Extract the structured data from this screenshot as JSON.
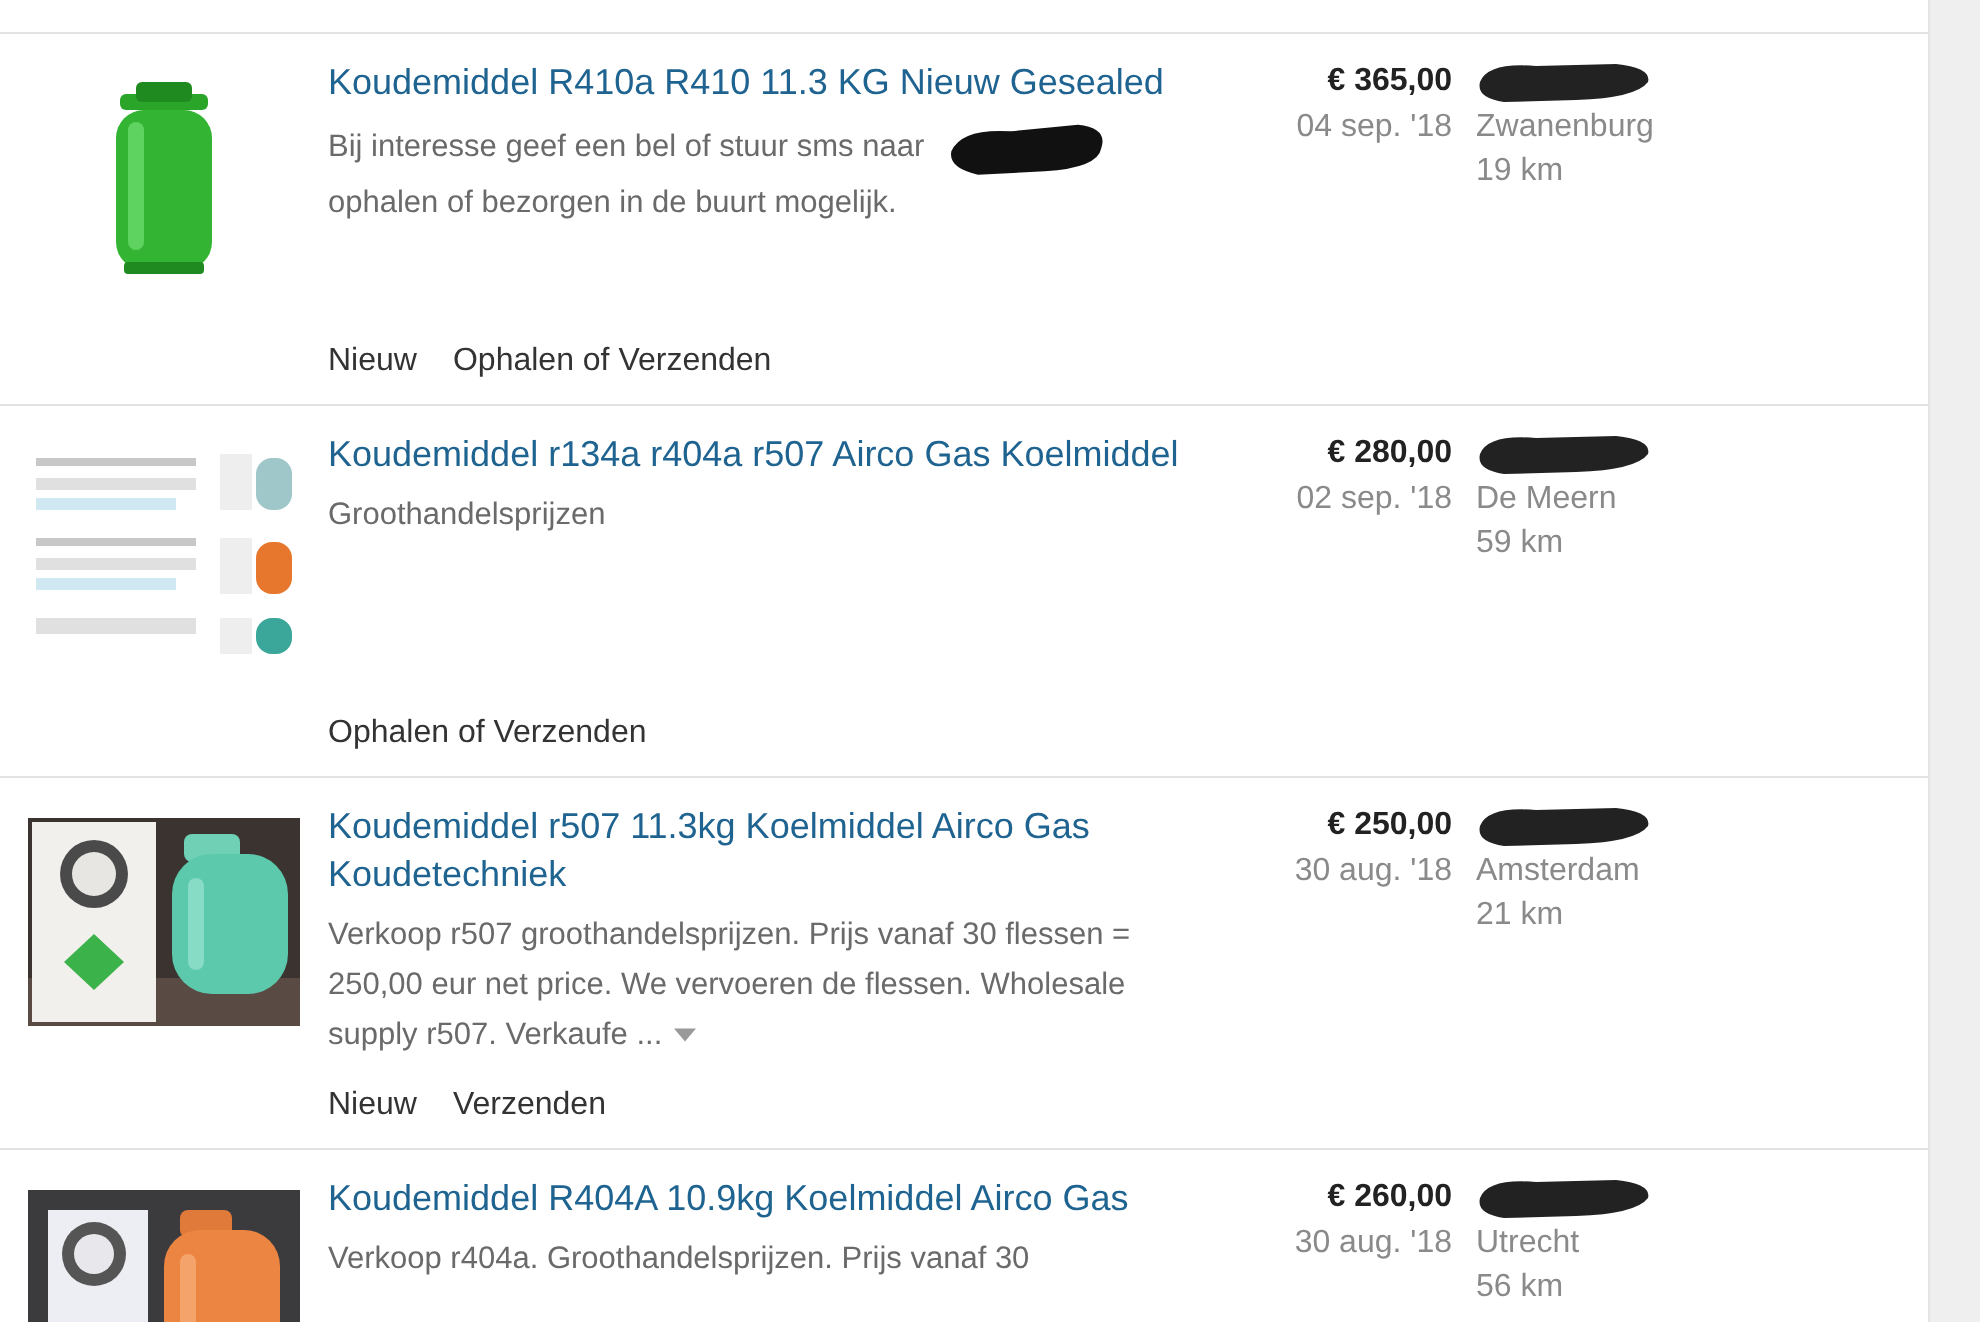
{
  "listings": [
    {
      "title": "Koudemiddel R410a R410 11.3 KG Nieuw Gesealed",
      "image": {
        "kind": "picture"
      },
      "description": [
        "Bij interesse geef een bel of stuur sms naar",
        "ophalen of bezorgen in de buurt mogelijk."
      ],
      "redacted_phone": true,
      "attributes": [
        "Nieuw",
        "Ophalen of Verzenden"
      ],
      "price": "€ 365,00",
      "date": "04 sep. '18",
      "seller_redacted": true,
      "location": "Zwanenburg",
      "distance": "19 km"
    },
    {
      "title": "Koudemiddel r134a r404a r507 Airco Gas Koelmiddel",
      "image": {
        "kind": "picture"
      },
      "description": [
        "Groothandelsprijzen"
      ],
      "attributes": [
        "Ophalen of Verzenden"
      ],
      "price": "€ 280,00",
      "date": "02 sep. '18",
      "seller_redacted": true,
      "location": "De Meern",
      "distance": "59 km"
    },
    {
      "title": "Koudemiddel r507 11.3kg Koelmiddel Airco Gas Koudetechniek",
      "image": {
        "kind": "picture"
      },
      "description": [
        "Verkoop r507 groothandelsprijzen. Prijs vanaf 30 flessen = 250,00 eur net price. We vervoeren de flessen. Wholesale supply r507. Verkaufe ..."
      ],
      "expandable": true,
      "attributes": [
        "Nieuw",
        "Verzenden"
      ],
      "price": "€ 250,00",
      "date": "30 aug. '18",
      "seller_redacted": true,
      "location": "Amsterdam",
      "distance": "21 km"
    },
    {
      "title": "Koudemiddel R404A 10.9kg Koelmiddel Airco Gas",
      "image": {
        "kind": "picture"
      },
      "description": [
        "Verkoop r404a. Groothandelsprijzen. Prijs vanaf 30"
      ],
      "price": "€ 260,00",
      "date": "30 aug. '18",
      "seller_redacted": true,
      "location": "Utrecht",
      "distance": "56 km"
    }
  ]
}
